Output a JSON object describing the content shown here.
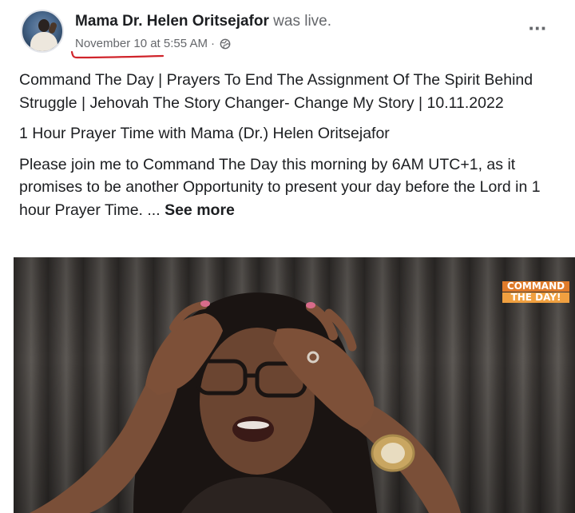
{
  "post": {
    "author_name": "Mama Dr. Helen Oritsejafor",
    "action_text": "was live.",
    "date": "November 10",
    "at_text": "at",
    "time": "5:55 AM",
    "separator": "·",
    "audience_icon": "globe-icon",
    "more_icon": "more-options-icon",
    "more_glyph": "···",
    "paragraphs": [
      "Command The Day | Prayers To End The Assignment Of The Spirit Behind Struggle | Jehovah The Story Changer- Change My Story | 10.11.2022",
      "1 Hour Prayer Time with Mama (Dr.) Helen Oritsejafor",
      "Please join me to Command The Day this morning by 6AM UTC+1, as it promises to be another Opportunity to present your day before the Lord in 1 hour Prayer Time. ..."
    ],
    "see_more": "See more",
    "annotation_color": "#d0242b"
  },
  "video": {
    "watermark_line1": "COMMAND",
    "watermark_line2": "THE DAY!",
    "watermark_color": "#e07b2a"
  }
}
